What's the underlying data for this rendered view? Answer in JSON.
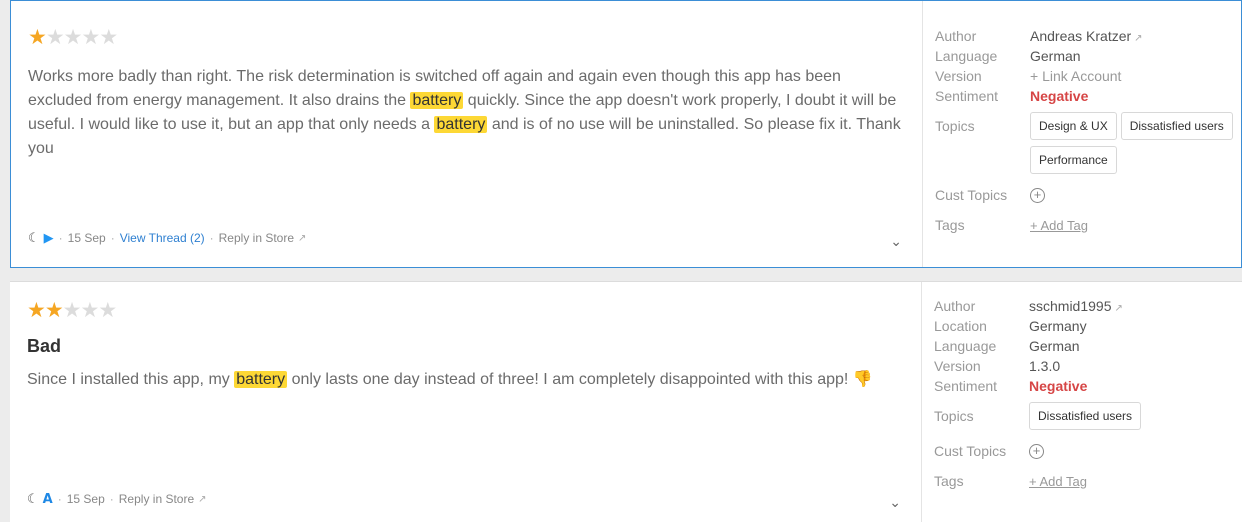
{
  "reviews": [
    {
      "stars_filled": 1,
      "stars_total": 5,
      "title": "",
      "body_parts": [
        "Works more badly than right. The risk determination is switched off again and again even though this app has been excluded from energy management. It also drains the ",
        "battery",
        " quickly. Since the app doesn't work properly, I doubt it will be useful. I would like to use it, but an app that only needs a ",
        "battery",
        " and is of no use will be uninstalled. So please fix it. Thank you"
      ],
      "date": "15 Sep",
      "view_thread": "View Thread (2)",
      "reply": "Reply in Store",
      "store_icon": "google-play-icon",
      "meta": {
        "author_label": "Author",
        "author": "Andreas Kratzer",
        "language_label": "Language",
        "language": "German",
        "version_label": "Version",
        "version": "+ Link Account",
        "sentiment_label": "Sentiment",
        "sentiment": "Negative",
        "topics_label": "Topics",
        "topics": [
          "Design & UX",
          "Dissatisfied users",
          "Performance"
        ],
        "cust_topics_label": "Cust Topics",
        "tags_label": "Tags",
        "add_tag": "+ Add Tag"
      }
    },
    {
      "stars_filled": 2,
      "stars_total": 5,
      "title": "Bad",
      "body_parts": [
        "Since I installed this app, my ",
        "battery",
        " only lasts one day instead of three! I am completely disappointed with this app! ",
        "👎"
      ],
      "date": "15 Sep",
      "reply": "Reply in Store",
      "store_icon": "app-store-icon",
      "meta": {
        "author_label": "Author",
        "author": "sschmid1995",
        "location_label": "Location",
        "location": "Germany",
        "language_label": "Language",
        "language": "German",
        "version_label": "Version",
        "version": "1.3.0",
        "sentiment_label": "Sentiment",
        "sentiment": "Negative",
        "topics_label": "Topics",
        "topics": [
          "Dissatisfied users"
        ],
        "cust_topics_label": "Cust Topics",
        "tags_label": "Tags",
        "add_tag": "+ Add Tag"
      }
    }
  ],
  "icons": {
    "source": "appfollow-icon",
    "external": "external-link-icon",
    "expand": "chevron-down-icon",
    "add": "plus-circle-icon"
  },
  "colors": {
    "accent": "#2f80d1",
    "highlight": "#fdd835",
    "star": "#f5a623",
    "negative": "#d64545",
    "selected_border": "#3b8ed6"
  }
}
